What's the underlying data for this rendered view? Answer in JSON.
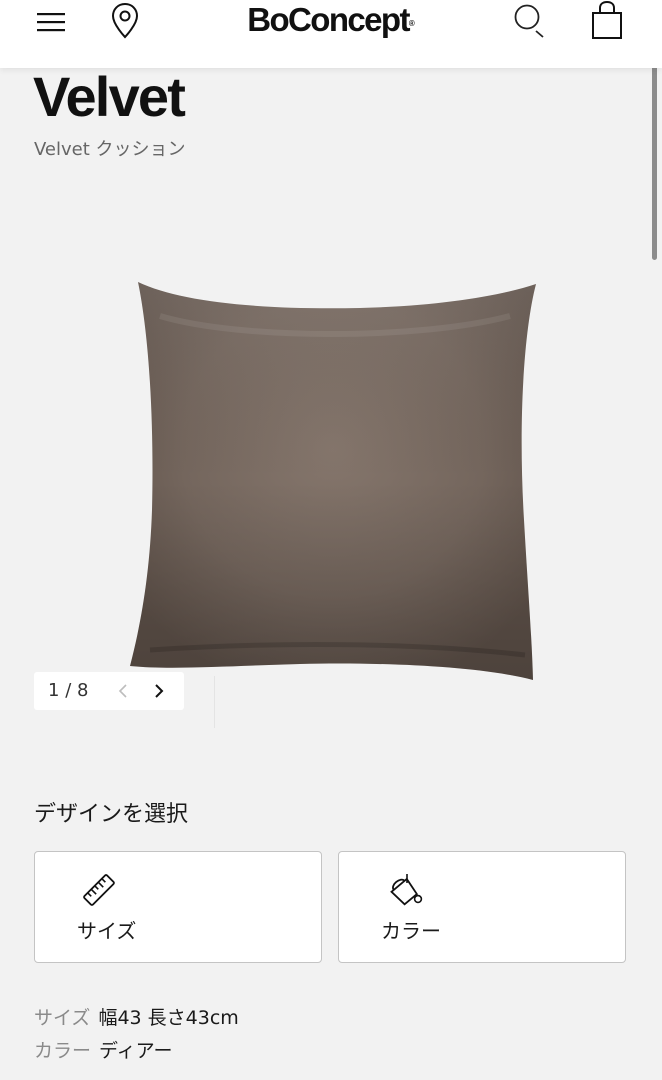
{
  "header": {
    "brand": "BoConcept",
    "brand_mark": "®",
    "icons": [
      "menu-icon",
      "location-pin-icon",
      "search-icon",
      "shopping-bag-icon"
    ]
  },
  "product": {
    "title": "Velvet",
    "subtitle": "Velvet クッション",
    "image_alt_color": "#7a6a60"
  },
  "gallery": {
    "current": "1",
    "separator": "/",
    "total": "8"
  },
  "design": {
    "heading": "デザインを選択",
    "options": [
      {
        "label": "サイズ",
        "icon": "ruler-icon"
      },
      {
        "label": "カラー",
        "icon": "paint-bucket-icon"
      }
    ]
  },
  "specs": {
    "size_key": "サイズ",
    "size_value": "幅43 長さ43cm",
    "color_key": "カラー",
    "color_value": "ディアー"
  },
  "colors": {
    "background": "#f2f2f2",
    "header": "#ffffff",
    "text": "#1a1a1a",
    "muted": "#8a8a8a",
    "card_border": "#c4c4c4",
    "cushion": "#74665d"
  }
}
